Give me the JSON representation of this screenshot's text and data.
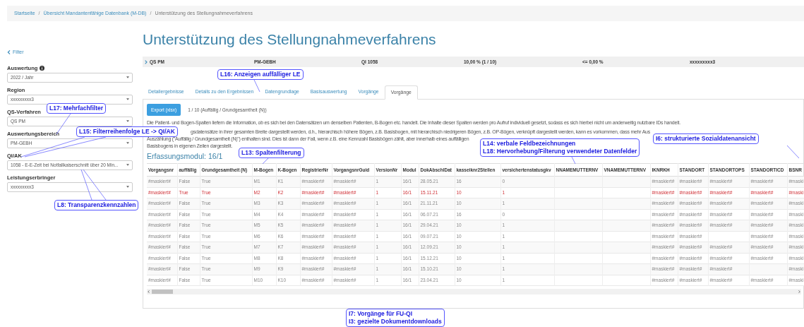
{
  "breadcrumb": {
    "separator": "/",
    "items": [
      {
        "label": "Startseite",
        "kind": "link"
      },
      {
        "label": "Übersicht Mandantenfähige Datenbank (M-DB)",
        "kind": "link"
      },
      {
        "label": "Unterstützung des Stellungnahmeverfahrens",
        "kind": "current"
      }
    ]
  },
  "sidebar": {
    "toggle": "Filter",
    "filters": [
      {
        "label": "Auswertung",
        "info": true,
        "value": "2022 / Jahr"
      },
      {
        "label": "Region",
        "info": false,
        "value": "xxxxxxxxx3"
      },
      {
        "label": "QS-Verfahren",
        "info": false,
        "value": "QS PM"
      },
      {
        "label": "Auswertungsbereich",
        "info": false,
        "value": "PM-GEBH"
      },
      {
        "label": "QI/AK",
        "info": false,
        "value": "1058 - E-E-Zeit bei Notfallkaiserschnitt über 20 Min..."
      },
      {
        "label": "Leistungserbringer",
        "info": false,
        "value": "xxxxxxxxx3"
      }
    ]
  },
  "title": "Unterstützung des Stellungnahmeverfahrens",
  "summary": [
    "QS PM",
    "PM-GEBH",
    "QI 1058",
    "10,00 % (1 / 10)",
    "<= 0,00 %",
    "xxxxxxxxx3"
  ],
  "tabs": [
    {
      "label": "Detailergebnisse",
      "selected": false
    },
    {
      "label": "Details zu den Ergebnissen",
      "selected": false
    },
    {
      "label": "Datengrundlage",
      "selected": false
    },
    {
      "label": "Basisauswertung",
      "selected": false
    },
    {
      "label": "Vorgänge",
      "selected": false
    },
    {
      "label": "Vorgänge",
      "selected": true
    }
  ],
  "export_button": "Export (xlsx)",
  "count": "1 / 10 (Auffällig / Grundgesamtheit (N))",
  "paragraph_1": "Die Patient- und Bogen-Spalten liefern die Information, ob es sich bei den Datensätzen um denselben Patienten, B-Bogen etc. handelt. Die Inhalte dieser Spalten werden pro Aufruf individuell gesetzt, sodass es sich hierbei nicht um anderweitig nutzbare IDs handelt.",
  "paragraph_2_lines": [
    "gsdatensätze in ihrer gesamten Breite dargestellt werden, d.h., hierarchisch höhere Bögen, z.B. Basisbogen, mit hierarchisch niedrigeren Bögen, z.B. OP-Bögen, verknüpft dargestellt werden, kann es vorkommen, dass mehr Aus",
    "Auszählung (\"Auffällig / Grundgesamtheit (N)\") enthalten sind. Dies ist dann der Fall, wenn z.B. eine Kennzahl Basisbögen zählt, aber innerhalb eines auffälligen",
    "Basisbogens in eigenen Zeilen dargestellt."
  ],
  "section_title": "Erfassungsmodul: 16/1",
  "table": {
    "columns": [
      "Vorgangsnr",
      "auffällig",
      "Grundgesamtheit (N)",
      "M-Bogen",
      "K-Bogen",
      "RegistrierNr",
      "VorgangsnrGuid",
      "VersionNr",
      "Modul",
      "DokAbschlDat",
      "kasseiknr2Stellen",
      "versichertenstatusgkv",
      "NNAMEMUTTERNV",
      "VNAMEMUTTERNV",
      "IKNRKH",
      "STANDORT",
      "STANDORTOPS",
      "STANDORTICD",
      "BSNR"
    ],
    "rows": [
      {
        "highlighted": false,
        "cells": [
          "#maskiert#",
          "False",
          "True",
          "M1",
          "K1",
          "#maskiert#",
          "#maskiert#",
          "1",
          "16/1",
          "28.05.21",
          "16",
          "0",
          null,
          null,
          "#maskiert#",
          "#maskiert#",
          "#maskiert#",
          "#maskiert#",
          "#maski"
        ]
      },
      {
        "highlighted": true,
        "cells": [
          "#maskiert#",
          "True",
          "True",
          "M2",
          "K2",
          "#maskiert#",
          "#maskiert#",
          "1",
          "16/1",
          "15.11.21",
          "10",
          "1",
          null,
          null,
          "#maskiert#",
          "#maskiert#",
          "#maskiert#",
          "#maskiert#",
          "#maski"
        ]
      },
      {
        "highlighted": false,
        "cells": [
          "#maskiert#",
          "False",
          "True",
          "M3",
          "K3",
          "#maskiert#",
          "#maskiert#",
          "1",
          "16/1",
          "21.11.21",
          "10",
          "1",
          null,
          null,
          "#maskiert#",
          "#maskiert#",
          "#maskiert#",
          "#maskiert#",
          "#maski"
        ]
      },
      {
        "highlighted": false,
        "cells": [
          "#maskiert#",
          "False",
          "True",
          "M4",
          "K4",
          "#maskiert#",
          "#maskiert#",
          "1",
          "16/1",
          "06.07.21",
          "16",
          "0",
          null,
          null,
          "#maskiert#",
          "#maskiert#",
          "#maskiert#",
          "#maskiert#",
          "#maski"
        ]
      },
      {
        "highlighted": false,
        "cells": [
          "#maskiert#",
          "False",
          "True",
          "M5",
          "K5",
          "#maskiert#",
          "#maskiert#",
          "1",
          "16/1",
          "29.04.21",
          "10",
          "1",
          null,
          null,
          "#maskiert#",
          "#maskiert#",
          "#maskiert#",
          "#maskiert#",
          "#maski"
        ]
      },
      {
        "highlighted": false,
        "cells": [
          "#maskiert#",
          "False",
          "True",
          "M6",
          "K6",
          "#maskiert#",
          "#maskiert#",
          "1",
          "16/1",
          "09.07.21",
          "10",
          "1",
          null,
          null,
          "#maskiert#",
          "#maskiert#",
          null,
          "#maskiert#",
          "#maski"
        ]
      },
      {
        "highlighted": false,
        "cells": [
          "#maskiert#",
          "False",
          "True",
          "M7",
          "K7",
          "#maskiert#",
          "#maskiert#",
          "1",
          "16/1",
          "12.09.21",
          "10",
          "1",
          null,
          null,
          "#maskiert#",
          "#maskiert#",
          "#maskiert#",
          "#maskiert#",
          "#maski"
        ]
      },
      {
        "highlighted": false,
        "cells": [
          "#maskiert#",
          "False",
          "True",
          "M8",
          "K8",
          "#maskiert#",
          "#maskiert#",
          "1",
          "16/1",
          "15.12.21",
          "10",
          "1",
          null,
          null,
          "#maskiert#",
          "#maskiert#",
          "#maskiert#",
          "#maskiert#",
          "#maski"
        ]
      },
      {
        "highlighted": false,
        "cells": [
          "#maskiert#",
          "False",
          "True",
          "M9",
          "K9",
          "#maskiert#",
          "#maskiert#",
          "1",
          "16/1",
          "15.10.21",
          "10",
          "1",
          null,
          null,
          "#maskiert#",
          "#maskiert#",
          "#maskiert#",
          null,
          "#maski"
        ]
      },
      {
        "highlighted": false,
        "cells": [
          "#maskiert#",
          "False",
          "True",
          "M10",
          "K10",
          "#maskiert#",
          "#maskiert#",
          "1",
          "16/1",
          "23.04.21",
          "10",
          "1",
          null,
          null,
          "#maskiert#",
          "#maskiert#",
          "#maskiert#",
          "#maskiert#",
          "#maski"
        ]
      }
    ]
  },
  "callouts": [
    {
      "lines": [
        "L16: Anzeigen auffälliger LE"
      ]
    },
    {
      "lines": [
        "L17: Mehrfachfilter"
      ]
    },
    {
      "lines": [
        "L15: Filterreihenfolge LE -> QI/AK"
      ]
    },
    {
      "lines": [
        "L8: Transparenzkennzahlen"
      ]
    },
    {
      "lines": [
        "L13: Spaltenfilterung"
      ]
    },
    {
      "lines": [
        "L14: verbale Feldbezeichnungen",
        "L18: Hervorhebung/Filterung verwendeter Datenfelder"
      ]
    },
    {
      "lines": [
        "I6: strukturierte Sozialdatenansicht"
      ]
    },
    {
      "lines": [
        "I7: Vorgänge für FU-QI",
        "I3: gezielte Dokumentdownloads"
      ]
    }
  ]
}
